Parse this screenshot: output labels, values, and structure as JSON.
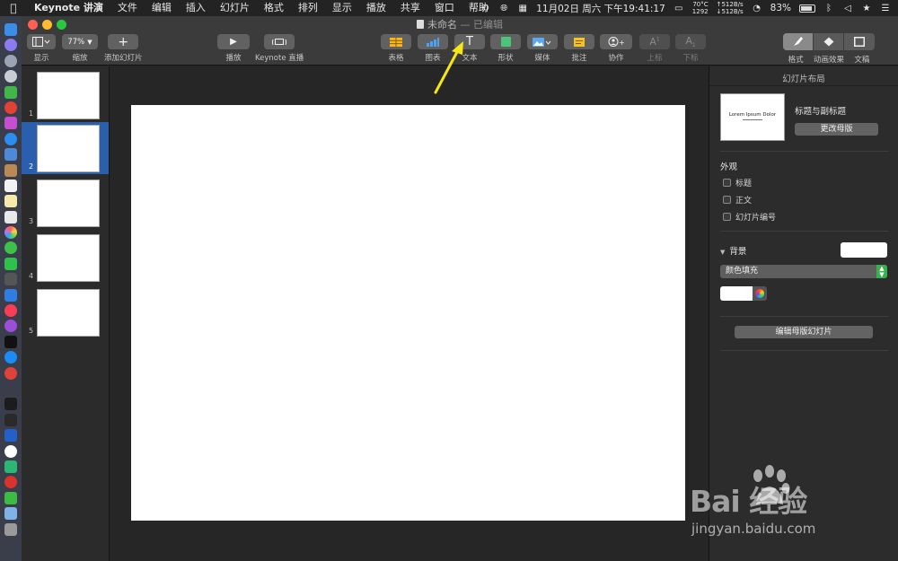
{
  "menubar": {
    "app": "Keynote 讲演",
    "items": [
      "文件",
      "编辑",
      "插入",
      "幻灯片",
      "格式",
      "排列",
      "显示",
      "播放",
      "共享",
      "窗口",
      "帮助"
    ],
    "temp": "70°C",
    "fan": "1292",
    "net_up": "↑512B/s",
    "net_down": "↓512B/s",
    "datetime": "11月02日 周六 下午19:41:17",
    "battery": "83%",
    "battery_level": 0.83
  },
  "window": {
    "title": "未命名",
    "title_suffix": "— 已编辑"
  },
  "toolbar": {
    "view_label": "显示",
    "zoom_value": "77%",
    "zoom_label": "缩放",
    "add_slide_label": "添加幻灯片",
    "play_label": "播放",
    "keynote_live_label": "Keynote 直播",
    "table_label": "表格",
    "chart_label": "图表",
    "text_label": "文本",
    "shape_label": "形状",
    "media_label": "媒体",
    "comment_label": "批注",
    "collaborate_label": "协作",
    "superscript_label": "上标",
    "subscript_label": "下标",
    "format_label": "格式",
    "animate_label": "动画效果",
    "document_label": "文稿"
  },
  "navigator": {
    "slides": [
      "1",
      "2",
      "3",
      "4",
      "5"
    ],
    "selected_index": 1
  },
  "inspector": {
    "title": "幻灯片布局",
    "master_preview_text": "Lorem Ipsum Dolor",
    "master_name": "标题与副标题",
    "change_master": "更改母版",
    "appearance_label": "外观",
    "appearance_options": [
      "标题",
      "正文",
      "幻灯片编号"
    ],
    "background_label": "背景",
    "fill_type": "颜色填充",
    "edit_master": "编辑母版幻灯片"
  },
  "watermark": {
    "brand": "Bai 经验",
    "url": "jingyan.baidu.com"
  },
  "colors": {
    "selection": "#2a5fad",
    "annotation_arrow": "#f5e614",
    "toggle_green": "#37b24d"
  }
}
